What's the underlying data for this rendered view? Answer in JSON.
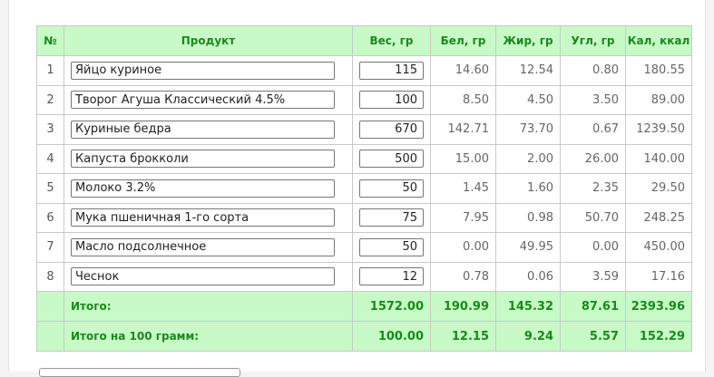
{
  "table": {
    "headers": {
      "num": "№",
      "product": "Продукт",
      "weight": "Вес, гр",
      "protein": "Бел, гр",
      "fat": "Жир, гр",
      "carbs": "Угл, гр",
      "kcal": "Кал, ккал"
    },
    "rows": [
      {
        "num": "1",
        "product": "Яйцо куриное",
        "weight": "115",
        "protein": "14.60",
        "fat": "12.54",
        "carbs": "0.80",
        "kcal": "180.55"
      },
      {
        "num": "2",
        "product": "Творог Агуша Классический 4.5%",
        "weight": "100",
        "protein": "8.50",
        "fat": "4.50",
        "carbs": "3.50",
        "kcal": "89.00"
      },
      {
        "num": "3",
        "product": "Куриные бедра",
        "weight": "670",
        "protein": "142.71",
        "fat": "73.70",
        "carbs": "0.67",
        "kcal": "1239.50"
      },
      {
        "num": "4",
        "product": "Капуста брокколи",
        "weight": "500",
        "protein": "15.00",
        "fat": "2.00",
        "carbs": "26.00",
        "kcal": "140.00"
      },
      {
        "num": "5",
        "product": "Молоко 3.2%",
        "weight": "50",
        "protein": "1.45",
        "fat": "1.60",
        "carbs": "2.35",
        "kcal": "29.50"
      },
      {
        "num": "6",
        "product": "Мука пшеничная 1-го сорта",
        "weight": "75",
        "protein": "7.95",
        "fat": "0.98",
        "carbs": "50.70",
        "kcal": "248.25"
      },
      {
        "num": "7",
        "product": "Масло подсолнечное",
        "weight": "50",
        "protein": "0.00",
        "fat": "49.95",
        "carbs": "0.00",
        "kcal": "450.00"
      },
      {
        "num": "8",
        "product": "Чеснок",
        "weight": "12",
        "protein": "0.78",
        "fat": "0.06",
        "carbs": "3.59",
        "kcal": "17.16"
      }
    ],
    "total": {
      "label": "Итого:",
      "weight": "1572.00",
      "protein": "190.99",
      "fat": "145.32",
      "carbs": "87.61",
      "kcal": "2393.96"
    },
    "per100": {
      "label": "Итого на 100 грамм:",
      "weight": "100.00",
      "protein": "12.15",
      "fat": "9.24",
      "carbs": "5.57",
      "kcal": "152.29"
    }
  },
  "colors": {
    "header_bg": "#c7fac7",
    "header_text": "#1a8a1a",
    "border": "#c9c9c9"
  }
}
